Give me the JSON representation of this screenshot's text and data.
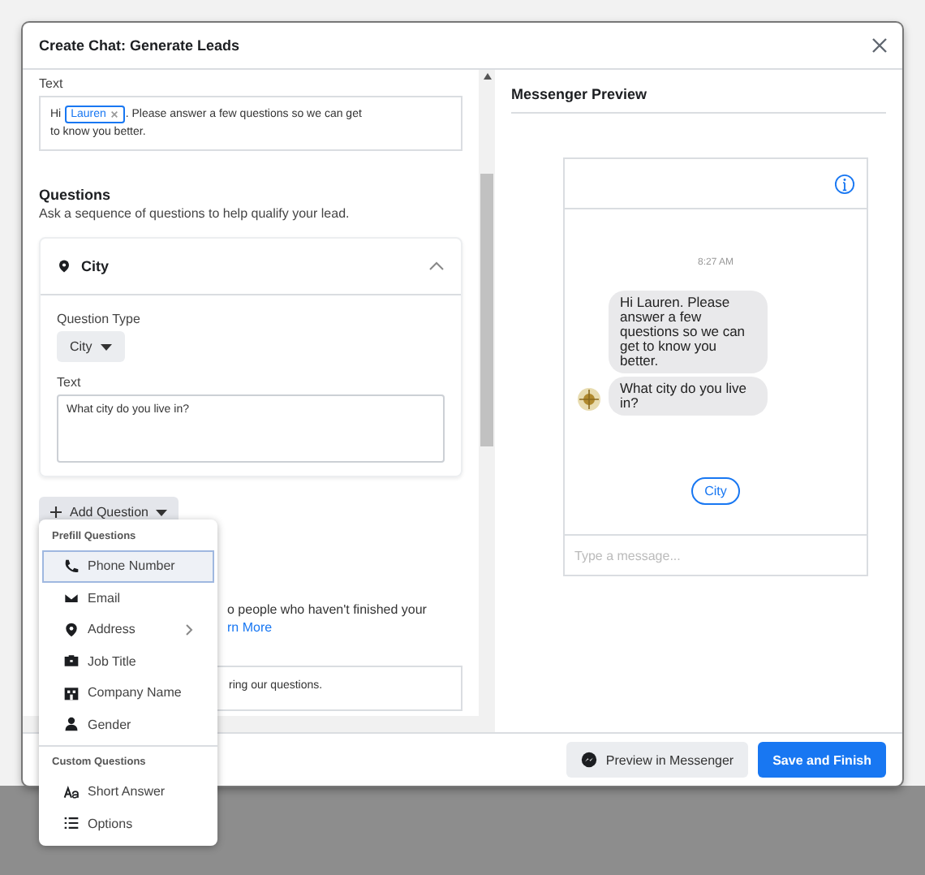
{
  "dialog": {
    "title": "Create Chat: Generate Leads"
  },
  "greeting": {
    "label": "Text",
    "before": "Hi",
    "token": "Lauren",
    "after": ". Please answer a few questions so we can get to know you better."
  },
  "questions": {
    "title": "Questions",
    "subtitle": "Ask a sequence of questions to help qualify your lead.",
    "card": {
      "name": "City",
      "expanded": true,
      "type_label": "Question Type",
      "type_value": "City",
      "text_label": "Text",
      "text_value": "What city do you live in?"
    },
    "add_button": "Add Question"
  },
  "hidden_section": {
    "description": "o people who haven't finished your",
    "link": "rn More",
    "field_value": "ring our questions."
  },
  "menu": {
    "sections": [
      {
        "title": "Prefill Questions",
        "items": [
          {
            "label": "Phone Number",
            "selected": true,
            "submenu": false
          },
          {
            "label": "Email",
            "selected": false,
            "submenu": false
          },
          {
            "label": "Address",
            "selected": false,
            "submenu": true
          },
          {
            "label": "Job Title",
            "selected": false,
            "submenu": false
          },
          {
            "label": "Company Name",
            "selected": false,
            "submenu": false
          },
          {
            "label": "Gender",
            "selected": false,
            "submenu": false
          }
        ]
      },
      {
        "title": "Custom Questions",
        "items": [
          {
            "label": "Short Answer",
            "selected": false,
            "submenu": false
          },
          {
            "label": "Options",
            "selected": false,
            "submenu": false
          }
        ]
      }
    ]
  },
  "preview": {
    "title": "Messenger Preview",
    "time": "8:27 AM",
    "messages": [
      "Hi Lauren. Please answer a few questions so we can get to know you better.",
      "What city do you live in?"
    ],
    "quick_reply": "City",
    "placeholder": "Type a message..."
  },
  "footer": {
    "buttons": [
      {
        "label": "Preview in Messenger",
        "kind": "secondary"
      },
      {
        "label": "Save and Finish",
        "kind": "primary"
      }
    ]
  }
}
